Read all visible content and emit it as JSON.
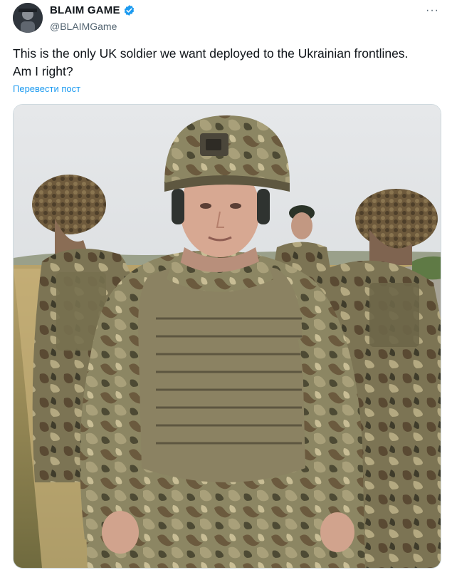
{
  "tweet": {
    "author_name": "BLAIM GAME",
    "author_handle": "@BLAIMGame",
    "text_line1": "This is the only UK soldier we want deployed to the Ukrainian frontlines.",
    "text_line2": "Am I right?",
    "translate_label": "Перевести пост",
    "more_label": "···"
  },
  "icons": {
    "verified": "verified-badge-icon",
    "more": "more-options-icon"
  },
  "colors": {
    "link": "#1d9bf0",
    "secondary_text": "#536471",
    "verified": "#1d9bf0"
  }
}
